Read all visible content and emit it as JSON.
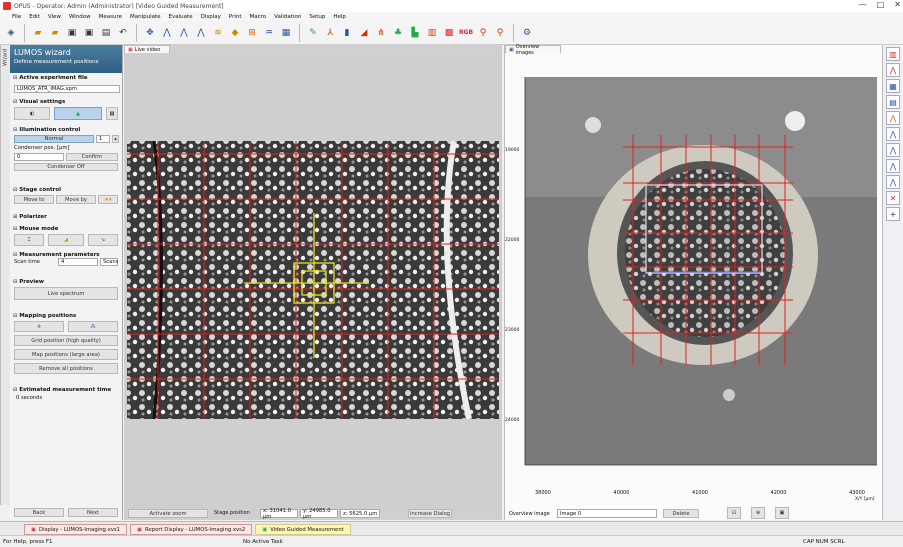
{
  "app": {
    "title": "OPUS - Operator: Admin  (Administrator)    [Video Guided Measurement]",
    "controls": [
      "—",
      "□",
      "✕"
    ]
  },
  "menu": [
    "File",
    "Edit",
    "View",
    "Window",
    "Measure",
    "Manipulate",
    "Evaluate",
    "Display",
    "Print",
    "Macro",
    "Validation",
    "Setup",
    "Help"
  ],
  "side_tab": "Wizard",
  "wizard": {
    "title": "LUMOS wizard",
    "subtitle": "Define measurement positions",
    "sections": {
      "active_exp": "Active experiment file",
      "visual": "Visual settings",
      "illumination": "Illumination control",
      "stage": "Stage control",
      "polarizer": "Polarizer",
      "mouse": "Mouse mode",
      "meas_params": "Measurement parameters",
      "preview": "Preview",
      "mapping": "Mapping positions",
      "estimated": "Estimated measurement time"
    },
    "exp_file": "LUMOS_ATR_IMAG.xpm",
    "illum_label": "Normal",
    "illum_value": "1",
    "condenser_label": "Condenser pos. [µm]",
    "condenser_value": "0",
    "condenser_btn": "Confirm",
    "condenser_off": "Condenser Off",
    "stage_btn1": "Move to",
    "stage_btn2": "Move by",
    "scan_time_label": "Scan time",
    "scan_time_value": "4",
    "scan_time_unit": "Scans",
    "live_spectrum": "Live spectrum",
    "grid_btn": "Grid position (high quality)",
    "grid_btn2": "Map positions (large area)",
    "remove_btn": "Remove all positions",
    "estimated_value": "0 seconds",
    "back": "Back",
    "next": "Next"
  },
  "live_panel": {
    "tab": "Live video",
    "buttons": [
      "Activate zoom",
      "Stage position",
      "x: 31041.0 µm",
      "y: 24985.0 µm",
      "z: 5625.0 µm",
      "Increase Dialog"
    ]
  },
  "overview_panel": {
    "tab": "Overview images",
    "x_ticks": [
      "38000",
      "40000",
      "41000",
      "42000",
      "43000"
    ],
    "y_ticks": [
      "19000",
      "22000",
      "23000",
      "24000"
    ],
    "unit": "X/Y [µm]",
    "overview_label": "Overview image",
    "overview_value": "Image 0",
    "delete": "Delete"
  },
  "right_icons": [
    "chart-icon",
    "spectrum-icon",
    "map-icon",
    "table-icon",
    "peak-icon",
    "peak2-icon",
    "line-icon",
    "line2-icon",
    "line3-icon",
    "cross-icon",
    "plus-icon"
  ],
  "taskbar": [
    {
      "label": "Display - LUMOS-Imaging.xvs1"
    },
    {
      "label": "Report Display - LUMOS-Imaging.xvs2"
    },
    {
      "label": "Video Guided Measurement",
      "active": true
    }
  ],
  "status": {
    "left": "For Help, press F1",
    "middle": "No Active Task",
    "right": "CAP NUM SCRL"
  }
}
